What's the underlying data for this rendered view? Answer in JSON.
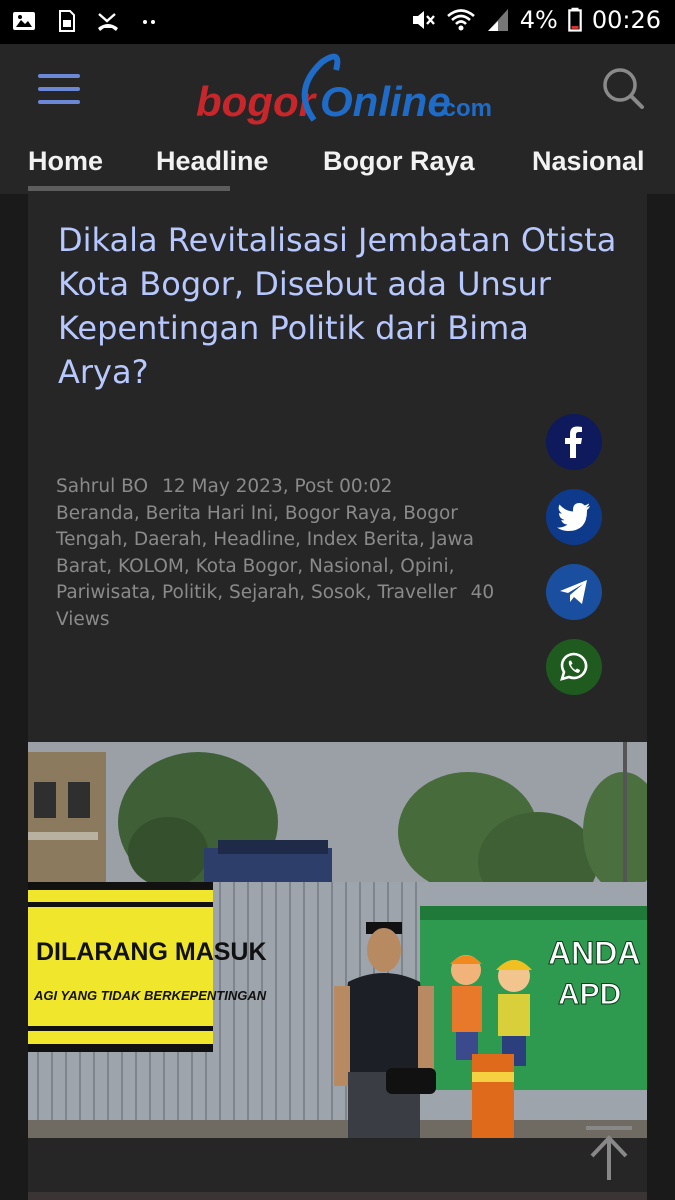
{
  "status_bar": {
    "battery": "4%",
    "time": "00:26",
    "icons": [
      "image-icon",
      "sim-icon",
      "missed-call-icon",
      "more-dots-icon",
      "mute-icon",
      "wifi-icon",
      "signal-icon",
      "battery-icon"
    ]
  },
  "header": {
    "logo_text_1": "bogor",
    "logo_text_2": "Online",
    "logo_text_3": ".com",
    "menu_icon": "hamburger-icon",
    "search_icon": "search-icon"
  },
  "nav": {
    "items": [
      {
        "label": "Home",
        "active": true
      },
      {
        "label": "Headline"
      },
      {
        "label": "Bogor Raya"
      },
      {
        "label": "Nasional"
      }
    ]
  },
  "article": {
    "title": "Dikala Revitalisasi Jembatan Otista Kota Bogor, Disebut ada Unsur Kepentingan Politik dari Bima Arya?",
    "author": "Sahrul BO",
    "date": "12 May 2023, Post 00:02",
    "categories": "Beranda, Berita Hari Ini, Bogor Raya, Bogor Tengah, Daerah, Headline, Index Berita, Jawa Barat, KOLOM, Kota Bogor, Nasional, Opini, Pariwisata, Politik, Sejarah, Sosok, Traveller",
    "views": "40 Views",
    "share": [
      {
        "name": "facebook",
        "color": "#0e1a5c"
      },
      {
        "name": "twitter",
        "color": "#0e3a8c"
      },
      {
        "name": "telegram",
        "color": "#1a4fa0"
      },
      {
        "name": "whatsapp",
        "color": "#1f5a1f"
      }
    ],
    "photo": {
      "sign_left_line1": "DILARANG MASUK",
      "sign_left_line2": "AGI YANG TIDAK BERKEPENTINGAN",
      "sign_right_line1": "ANDA",
      "sign_right_line2": "APD"
    }
  },
  "colors": {
    "title": "#b7c8ff",
    "logo_red": "#c8262a",
    "logo_blue": "#1f6cc8",
    "accent": "#6b87d6"
  }
}
